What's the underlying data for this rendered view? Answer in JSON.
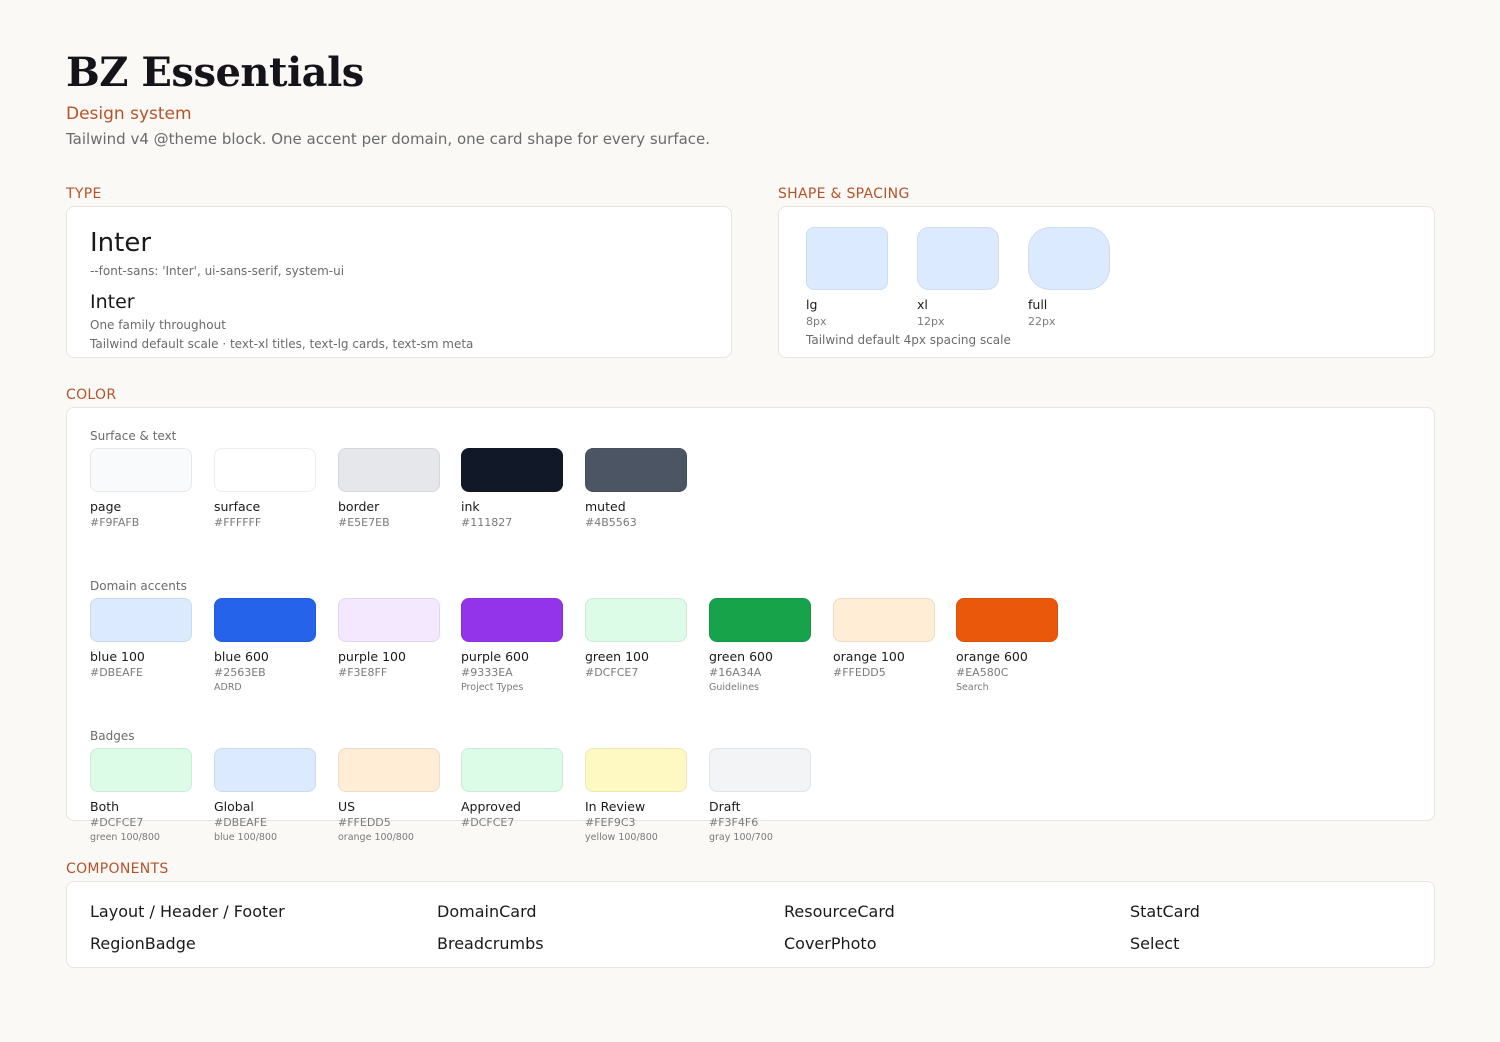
{
  "header": {
    "title": "BZ Essentials",
    "subtitle": "Design system",
    "description": "Tailwind v4 @theme block. One accent per domain, one card shape for every surface."
  },
  "sections": {
    "type": "TYPE",
    "shape": "SHAPE & SPACING",
    "color": "COLOR",
    "components": "COMPONENTS"
  },
  "type_card": {
    "primary_name": "Inter",
    "primary_css": "--font-sans: 'Inter', ui-sans-serif, system-ui",
    "secondary_name": "Inter",
    "secondary_note": "One family throughout",
    "scale_note": "Tailwind default scale · text-xl titles, text-lg cards, text-sm meta"
  },
  "shape_card": {
    "radii": [
      {
        "name": "lg",
        "value": "8px"
      },
      {
        "name": "xl",
        "value": "12px"
      },
      {
        "name": "full",
        "value": "22px"
      }
    ],
    "spacing_note": "Tailwind default 4px spacing scale",
    "swatch_color": "#DBEAFE"
  },
  "color": {
    "groups": [
      {
        "label": "Surface & text",
        "swatches": [
          {
            "name": "page",
            "hex": "#F9FAFB"
          },
          {
            "name": "surface",
            "hex": "#FFFFFF"
          },
          {
            "name": "border",
            "hex": "#E5E7EB"
          },
          {
            "name": "ink",
            "hex": "#111827"
          },
          {
            "name": "muted",
            "hex": "#4B5563"
          }
        ]
      },
      {
        "label": "Domain accents",
        "swatches": [
          {
            "name": "blue 100",
            "hex": "#DBEAFE"
          },
          {
            "name": "blue 600",
            "hex": "#2563EB",
            "note": "ADRD"
          },
          {
            "name": "purple 100",
            "hex": "#F3E8FF"
          },
          {
            "name": "purple 600",
            "hex": "#9333EA",
            "note": "Project Types"
          },
          {
            "name": "green 100",
            "hex": "#DCFCE7"
          },
          {
            "name": "green 600",
            "hex": "#16A34A",
            "note": "Guidelines"
          },
          {
            "name": "orange 100",
            "hex": "#FFEDD5"
          },
          {
            "name": "orange 600",
            "hex": "#EA580C",
            "note": "Search"
          }
        ]
      },
      {
        "label": "Badges",
        "swatches": [
          {
            "name": "Both",
            "hex": "#DCFCE7",
            "note": "green 100/800"
          },
          {
            "name": "Global",
            "hex": "#DBEAFE",
            "note": "blue 100/800"
          },
          {
            "name": "US",
            "hex": "#FFEDD5",
            "note": "orange 100/800"
          },
          {
            "name": "Approved",
            "hex": "#DCFCE7"
          },
          {
            "name": "In Review",
            "hex": "#FEF9C3",
            "note": "yellow 100/800"
          },
          {
            "name": "Draft",
            "hex": "#F3F4F6",
            "note": "gray 100/700"
          }
        ]
      }
    ]
  },
  "components": {
    "items": [
      "Layout / Header / Footer",
      "DomainCard",
      "ResourceCard",
      "StatCard",
      "RegionBadge",
      "Breadcrumbs",
      "CoverPhoto",
      "Select"
    ]
  }
}
